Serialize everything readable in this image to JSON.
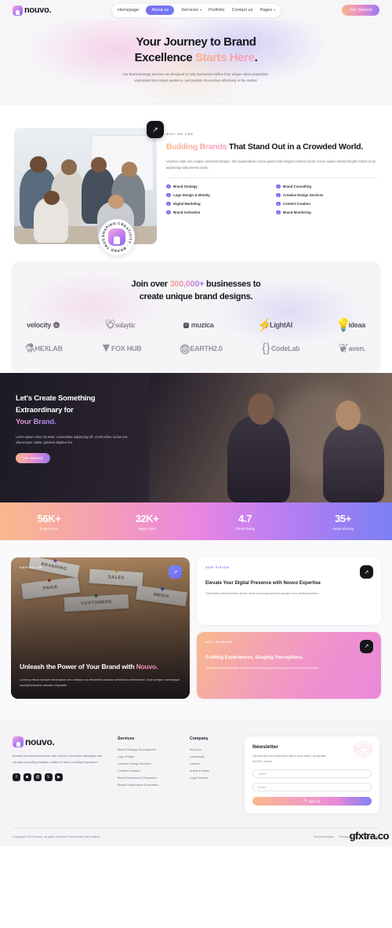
{
  "nav": {
    "brand": "nouvo.",
    "links": [
      {
        "label": "Homepage",
        "active": false,
        "caret": false
      },
      {
        "label": "About us",
        "active": true,
        "caret": false
      },
      {
        "label": "Services",
        "active": false,
        "caret": true
      },
      {
        "label": "Portfolio",
        "active": false,
        "caret": false
      },
      {
        "label": "Contact us",
        "active": false,
        "caret": false
      },
      {
        "label": "Pages",
        "active": false,
        "caret": true
      }
    ],
    "cta": "Get Started"
  },
  "hero": {
    "title_line1": "Your Journey to Brand",
    "title_line2a": "Excellence ",
    "title_line2b": "Starts Here",
    "title_line2c": ".",
    "paragraph": "Our brand strategy services are designed to help businesses define their unique value proposition, understand their target audience, and position themselves effectively in the market."
  },
  "about": {
    "eyebrow": "WHO WE ARE",
    "heading_accent": "Building Brands",
    "heading_rest": " That Stand Out in a Crowded World.",
    "body": "Vivamus vitae urci congue commodo tempus. Nisi suspendisse cursus quam nulla magnis euismod proin. Fusce sapien massa fringilla rutrum proin adipiscing nulla viverra morbi.",
    "stamp_text": "SHAPING CREATIVITY  BRAND TRUST  ",
    "arrow": "↗",
    "checks_left": [
      "Brand Strategy",
      "Logo Design & Identity",
      "Digital Marketing",
      "Brand Activation"
    ],
    "checks_right": [
      "Brand Consulting",
      "Creative Design Services",
      "Content Creation",
      "Brand Monitoring"
    ]
  },
  "logos": {
    "heading_pre": "Join over ",
    "heading_num": "300,000+",
    "heading_post": " businesses to",
    "heading_line2": "create unique brand designs.",
    "row1": [
      {
        "name": "velocity",
        "icon": "9",
        "icon_pos": "right",
        "style": "plain"
      },
      {
        "name": "solaytic",
        "icon": "heart",
        "icon_pos": "left",
        "style": "serif"
      },
      {
        "name": "muzica",
        "icon": "M",
        "icon_pos": "left",
        "style": "bold"
      },
      {
        "name": "LightAI",
        "icon": "bolt",
        "icon_pos": "left",
        "style": "plain"
      },
      {
        "name": "ideaa",
        "icon": "bulb",
        "icon_pos": "left",
        "style": "plain"
      }
    ],
    "row2": [
      {
        "name": "HEXLAB",
        "icon": "flask",
        "icon_pos": "left",
        "style": "bold"
      },
      {
        "name": "FOX HUB",
        "icon": "fox",
        "icon_pos": "left",
        "style": "bold"
      },
      {
        "name": "EARTH2.0",
        "icon": "globe",
        "icon_pos": "left",
        "style": "bold"
      },
      {
        "name": "CodeLab",
        "icon": "brackets",
        "icon_pos": "left",
        "style": "bold"
      },
      {
        "name": "aven.",
        "icon": "leaf",
        "icon_pos": "left",
        "style": "plain"
      }
    ]
  },
  "dark_cta": {
    "line1": "Let's Create Something",
    "line2": "Extraordinary for",
    "line3": "Your Brand.",
    "paragraph": "Lorem ipsum dolor sit amet, consectetur adipiscing elit. Ut elit tellus, luctus nec ullamcorper mattis, pulvinar dapibus leo.",
    "button": "Get Started"
  },
  "stats": [
    {
      "value": "56K+",
      "label": "Project Done"
    },
    {
      "value": "32K+",
      "label": "Happy Client"
    },
    {
      "value": "4.7",
      "label": "Clients Rating"
    },
    {
      "value": "35+",
      "label": "Award Winning"
    }
  ],
  "values": {
    "big_card": {
      "tag": "OUR VALUE",
      "arrow": "↗",
      "title_a": "Unleash the Power of Your Brand with ",
      "title_b": "Nouvo.",
      "paragraph": "Lorem pretium semper himenaeos sem massa non hendrerit nascetur vestibulum elementum. Erat semper scelerisque suscipit posuere natoque vulputate.",
      "stickies": [
        "PRICE",
        "SALES",
        "CUSTOMERS",
        "MEDIA",
        "BRANDING"
      ]
    },
    "vision_card": {
      "tag": "OUR VISION",
      "arrow": "↗",
      "title": "Elevate Your Digital Presence with Nouvo Expertise",
      "paragraph": "Taciti diam pulvinar finibus lectus morbi accumsan pretium quisque urna cubilia pharetra."
    },
    "mission_card": {
      "tag": "OUR MISSION",
      "arrow": "↗",
      "title": "Crafting Experiences, Shaping Perceptions.",
      "paragraph": "Taciti diam pulvinar finibus lectus morbi accumsan pretium quisque urna cubilia pharetra."
    }
  },
  "footer": {
    "brand": "nouvo.",
    "about": "Elevate your brand presence with Nouvo's innovative strategies and visually compelling designs, crafted to leave a lasting impression.",
    "socials": [
      "facebook-icon",
      "instagram-icon",
      "threads-icon",
      "x-icon",
      "youtube-icon"
    ],
    "services": {
      "title": "Services",
      "items": [
        "Brand Strategy Development",
        "Logo Design",
        "Creative Design Services",
        "Content Creation",
        "Brand Extension & Expansion",
        "Brand Performance Evaluation"
      ]
    },
    "company": {
      "title": "Company",
      "items": [
        "About us",
        "Leadership",
        "Careers",
        "Article & News",
        "Legal Notices"
      ]
    },
    "newsletter": {
      "title": "Newsletter",
      "description": "Get free tips and resources right in your inbox, along with 10,000+ others",
      "name_placeholder": "Name",
      "email_placeholder": "Email",
      "name_value": "",
      "email_value": "",
      "button": "Sign up",
      "button_icon": "✎"
    },
    "copyright": "Copyright© 2024 Nouvo. All rights reserved. Powered by MaxCreative",
    "legal_links": [
      "Term of services",
      "Privacy Policy",
      "Cookie Policy"
    ]
  },
  "watermark": "gfxtra.co"
}
